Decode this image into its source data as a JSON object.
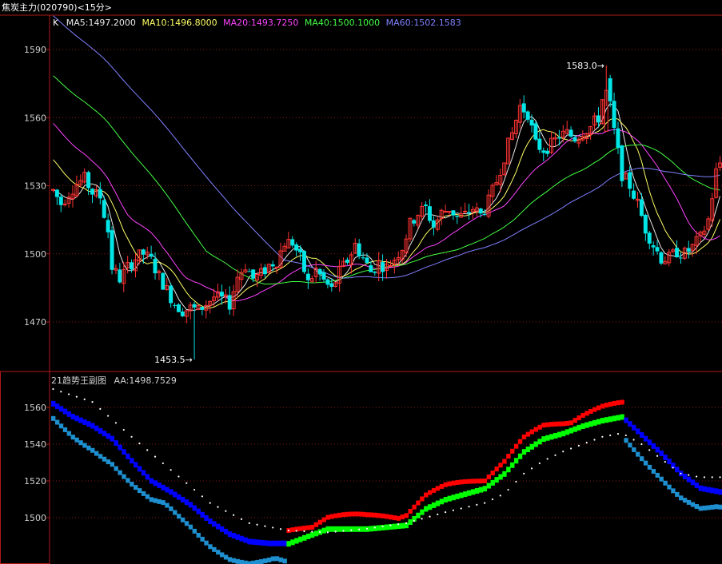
{
  "header": {
    "title": "焦炭主力",
    "code": "(020790)",
    "period": "<15分>"
  },
  "main_panel": {
    "indicator_prefix": "K",
    "ma_legend": [
      {
        "key": "MA5",
        "text": "MA5:1497.2000",
        "color": "#e8e8e8"
      },
      {
        "key": "MA10",
        "text": "MA10:1496.8000",
        "color": "#ffff66"
      },
      {
        "key": "MA20",
        "text": "MA20:1493.7250",
        "color": "#ff44ff"
      },
      {
        "key": "MA40",
        "text": "MA40:1500.1000",
        "color": "#44ff44"
      },
      {
        "key": "MA60",
        "text": "MA60:1502.1583",
        "color": "#8080ff"
      }
    ],
    "high_annotation": "1583.0",
    "low_annotation": "1453.5"
  },
  "sub_panel": {
    "name": "21趋势王副图",
    "value_label": "AA:1498.7529"
  },
  "colors": {
    "up": "#ff3333",
    "down": "#00e5e5",
    "panel_border": "#b01818",
    "grid": "#8b1a1a",
    "trend_up": "#ff0000",
    "trend_mid": "#00ff00",
    "trend_down": "#0000ff",
    "trend_lower": "#1e8fcf"
  },
  "chart_data": [
    {
      "type": "candlestick",
      "title": "焦炭主力(020790)<15分>",
      "yticks": [
        1470,
        1500,
        1530,
        1560,
        1590
      ],
      "ylim": [
        1450,
        1600
      ],
      "anchors": [
        [
          0,
          1528
        ],
        [
          2,
          1522
        ],
        [
          4,
          1527
        ],
        [
          6,
          1531
        ],
        [
          8,
          1533
        ],
        [
          10,
          1527
        ],
        [
          12,
          1525
        ],
        [
          14,
          1510
        ],
        [
          15,
          1494
        ],
        [
          17,
          1489
        ],
        [
          19,
          1494
        ],
        [
          21,
          1498
        ],
        [
          23,
          1500
        ],
        [
          25,
          1497
        ],
        [
          27,
          1490
        ],
        [
          29,
          1484
        ],
        [
          31,
          1478
        ],
        [
          33,
          1475
        ],
        [
          35,
          1476
        ],
        [
          37,
          1475
        ],
        [
          39,
          1478
        ],
        [
          41,
          1481
        ],
        [
          43,
          1480
        ],
        [
          45,
          1478
        ],
        [
          47,
          1490
        ],
        [
          49,
          1495
        ],
        [
          51,
          1489
        ],
        [
          53,
          1491
        ],
        [
          55,
          1495
        ],
        [
          57,
          1497
        ],
        [
          59,
          1505
        ],
        [
          61,
          1505
        ],
        [
          63,
          1498
        ],
        [
          65,
          1487
        ],
        [
          67,
          1493
        ],
        [
          69,
          1488
        ],
        [
          71,
          1484
        ],
        [
          73,
          1492
        ],
        [
          75,
          1497
        ],
        [
          77,
          1504
        ],
        [
          79,
          1498
        ],
        [
          81,
          1492
        ],
        [
          83,
          1496
        ],
        [
          85,
          1494
        ],
        [
          87,
          1498
        ],
        [
          89,
          1503
        ],
        [
          91,
          1513
        ],
        [
          93,
          1518
        ],
        [
          95,
          1520
        ],
        [
          97,
          1512
        ],
        [
          99,
          1518
        ],
        [
          101,
          1520
        ],
        [
          103,
          1516
        ],
        [
          105,
          1517
        ],
        [
          107,
          1520
        ],
        [
          109,
          1517
        ],
        [
          111,
          1523
        ],
        [
          113,
          1532
        ],
        [
          115,
          1543
        ],
        [
          117,
          1553
        ],
        [
          119,
          1565
        ],
        [
          121,
          1562
        ],
        [
          123,
          1548
        ],
        [
          125,
          1546
        ],
        [
          127,
          1548
        ],
        [
          129,
          1552
        ],
        [
          131,
          1553
        ],
        [
          133,
          1551
        ],
        [
          135,
          1554
        ],
        [
          137,
          1556
        ],
        [
          139,
          1560
        ],
        [
          141,
          1576
        ],
        [
          143,
          1554
        ],
        [
          145,
          1535
        ],
        [
          147,
          1530
        ],
        [
          149,
          1522
        ],
        [
          151,
          1511
        ],
        [
          153,
          1504
        ],
        [
          155,
          1498
        ],
        [
          157,
          1498
        ],
        [
          159,
          1501
        ],
        [
          161,
          1500
        ],
        [
          163,
          1503
        ],
        [
          165,
          1507
        ],
        [
          167,
          1515
        ],
        [
          169,
          1536
        ],
        [
          170,
          1540
        ]
      ],
      "high": 1583.0,
      "low": 1453.5,
      "ma": {
        "MA5": 1497.2,
        "MA10": 1496.8,
        "MA20": 1493.725,
        "MA40": 1500.1,
        "MA60": 1502.1583
      }
    },
    {
      "type": "line",
      "title": "21趋势王副图",
      "yticks": [
        1500,
        1520,
        1540,
        1560
      ],
      "ylim": [
        1480,
        1570
      ],
      "series": [
        {
          "name": "AA",
          "last": 1498.7529
        }
      ],
      "trend_anchors": [
        [
          0,
          1562
        ],
        [
          5,
          1555
        ],
        [
          10,
          1550
        ],
        [
          15,
          1543
        ],
        [
          20,
          1531
        ],
        [
          25,
          1520
        ],
        [
          30,
          1514
        ],
        [
          35,
          1507
        ],
        [
          40,
          1498
        ],
        [
          45,
          1491
        ],
        [
          50,
          1487
        ],
        [
          55,
          1486
        ],
        [
          60,
          1486
        ],
        [
          65,
          1490
        ],
        [
          70,
          1494
        ],
        [
          75,
          1494
        ],
        [
          80,
          1494
        ],
        [
          85,
          1495
        ],
        [
          90,
          1496
        ],
        [
          95,
          1505
        ],
        [
          100,
          1510
        ],
        [
          105,
          1513
        ],
        [
          110,
          1516
        ],
        [
          115,
          1524
        ],
        [
          120,
          1536
        ],
        [
          125,
          1543
        ],
        [
          130,
          1546
        ],
        [
          135,
          1550
        ],
        [
          140,
          1553
        ],
        [
          145,
          1555
        ],
        [
          150,
          1545
        ],
        [
          155,
          1535
        ],
        [
          160,
          1524
        ],
        [
          165,
          1516
        ],
        [
          170,
          1514
        ]
      ],
      "dotted_anchors": [
        [
          0,
          1570
        ],
        [
          10,
          1563
        ],
        [
          20,
          1544
        ],
        [
          30,
          1526
        ],
        [
          40,
          1508
        ],
        [
          50,
          1497
        ],
        [
          60,
          1493
        ],
        [
          70,
          1492
        ],
        [
          80,
          1494
        ],
        [
          90,
          1497
        ],
        [
          100,
          1503
        ],
        [
          110,
          1508
        ],
        [
          115,
          1513
        ],
        [
          120,
          1524
        ],
        [
          125,
          1531
        ],
        [
          130,
          1536
        ],
        [
          135,
          1540
        ],
        [
          140,
          1544
        ],
        [
          145,
          1546
        ],
        [
          150,
          1540
        ],
        [
          155,
          1532
        ],
        [
          160,
          1524
        ],
        [
          165,
          1522
        ],
        [
          170,
          1522
        ]
      ]
    }
  ]
}
